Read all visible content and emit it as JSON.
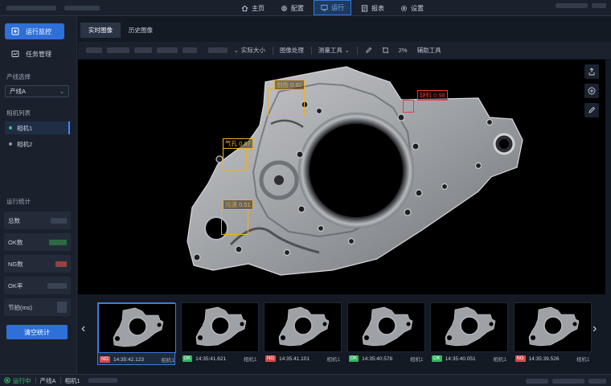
{
  "colors": {
    "accent": "#2f6fd8",
    "ok": "#36b35c",
    "ng": "#d24b4b",
    "running": "#39c46a",
    "defect_yellow": "#f2b01e",
    "defect_red": "#ef3b3b"
  },
  "nav": {
    "items": [
      {
        "label": "主页",
        "icon": "home-icon"
      },
      {
        "label": "配置",
        "icon": "gear-icon"
      },
      {
        "label": "运行",
        "icon": "run-icon"
      },
      {
        "label": "报表",
        "icon": "report-icon"
      },
      {
        "label": "设置",
        "icon": "settings-icon"
      }
    ],
    "active": "运行"
  },
  "sidebar": {
    "menu": [
      {
        "label": "运行监控",
        "icon": "monitor-icon"
      },
      {
        "label": "任务管理",
        "icon": "task-icon"
      }
    ],
    "line_select_label": "产线选择",
    "line_selected": "产线A",
    "camera_list_label": "相机列表",
    "cameras": [
      "相机1",
      "相机2"
    ],
    "stats_label": "运行统计",
    "stats": [
      {
        "label": "总数"
      },
      {
        "label": "OK数"
      },
      {
        "label": "NG数"
      },
      {
        "label": "OK率"
      },
      {
        "label": "节拍(ms)"
      }
    ],
    "clear_button": "清空统计"
  },
  "main": {
    "tabs": [
      "实时图像",
      "历史图像"
    ],
    "toolbar": {
      "actual_size": "实际大小",
      "image_process": "图像处理",
      "measure_tool": "测量工具",
      "zoom": "2%",
      "aux_tool": "辅助工具"
    },
    "defects": [
      {
        "label": "划伤 0.92",
        "color": "#f2b01e"
      },
      {
        "label": "缺料 0.98",
        "color": "#ef3b3b"
      },
      {
        "label": "气孔 0.87",
        "color": "#f2b01e"
      },
      {
        "label": "污渍 0.51",
        "color": "#f2b01e"
      }
    ]
  },
  "filmstrip": [
    {
      "result": "NG",
      "time": "14:35:42.123",
      "camera": "相机1"
    },
    {
      "result": "OK",
      "time": "14:35:41.621",
      "camera": "相机1"
    },
    {
      "result": "NG",
      "time": "14:35:41.101",
      "camera": "相机1"
    },
    {
      "result": "OK",
      "time": "14:35:40.578",
      "camera": "相机1"
    },
    {
      "result": "OK",
      "time": "14:35:40.051",
      "camera": "相机1"
    },
    {
      "result": "NG",
      "time": "14:35:39.526",
      "camera": "相机1"
    }
  ],
  "statusbar": {
    "running": "运行中",
    "line": "产线A",
    "camera": "相机1"
  }
}
